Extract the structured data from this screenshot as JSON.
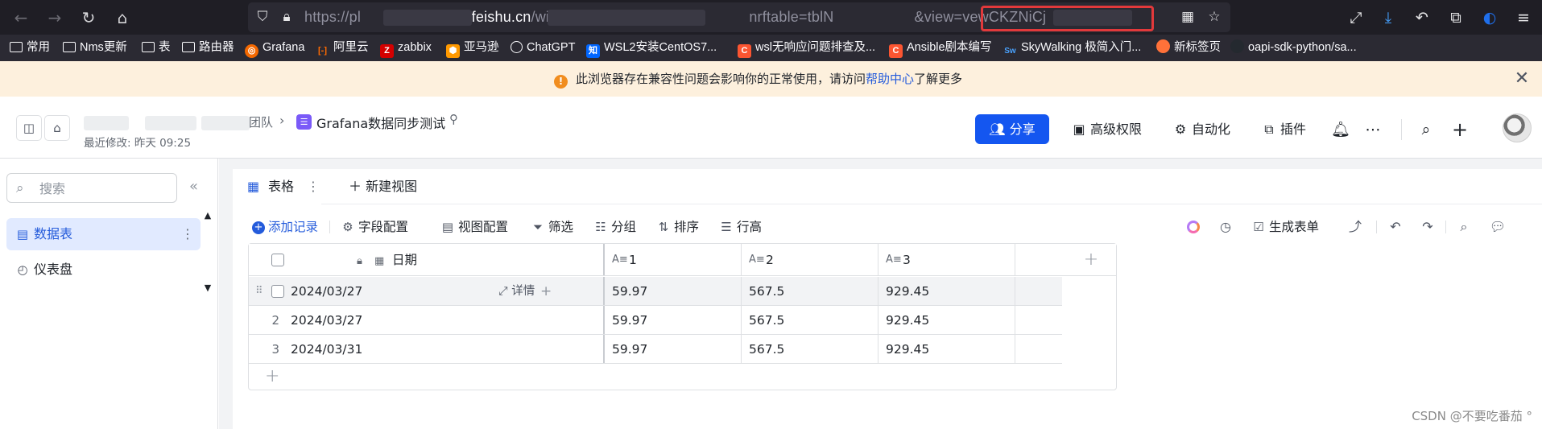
{
  "browser": {
    "url_prefix": "https://pl",
    "url_host": "e3.feishu.cn",
    "url_path": "/wiki/AJn",
    "url_mid": "nrf",
    "url_table": "table=tblN",
    "url_view": "&view=vewCKZNiCj"
  },
  "bookmarks": [
    {
      "label": "常用",
      "icon": "folder-icon"
    },
    {
      "label": "Nms更新",
      "icon": "folder-icon"
    },
    {
      "label": "表",
      "icon": "folder-icon"
    },
    {
      "label": "路由器",
      "icon": "folder-icon"
    },
    {
      "label": "Grafana",
      "icon": "grafana-icon"
    },
    {
      "label": "阿里云",
      "icon": "aliyun-icon"
    },
    {
      "label": "zabbix",
      "icon": "zabbix-icon"
    },
    {
      "label": "亚马逊",
      "icon": "amazon-icon"
    },
    {
      "label": "ChatGPT",
      "icon": "globe-icon"
    },
    {
      "label": "WSL2安装CentOS7...",
      "icon": "zhihu-icon"
    },
    {
      "label": "wsl无响应问题排查及...",
      "icon": "csdn-icon"
    },
    {
      "label": "Ansible剧本编写",
      "icon": "csdn-icon"
    },
    {
      "label": "SkyWalking 极简入门...",
      "icon": "skywalking-icon"
    },
    {
      "label": "新标签页",
      "icon": "firefox-icon"
    },
    {
      "label": "oapi-sdk-python/sa...",
      "icon": "github-icon"
    }
  ],
  "notice": {
    "text_before": "此浏览器存在兼容性问题会影响你的正常使用，请访问",
    "link": "帮助中心",
    "text_after": "了解更多"
  },
  "header": {
    "crumb_team": "团队",
    "doc_title": "Grafana数据同步测试",
    "last_modified": "最近修改: 昨天 09:25",
    "share_label": "分享",
    "permissions_label": "高级权限",
    "automation_label": "自动化",
    "plugins_label": "插件"
  },
  "sidebar": {
    "search_placeholder": "搜索",
    "items": [
      {
        "label": "数据表",
        "icon": "table-icon",
        "active": true
      },
      {
        "label": "仪表盘",
        "icon": "dashboard-icon",
        "active": false
      }
    ]
  },
  "tabs": {
    "active_label": "表格",
    "new_view_label": "新建视图"
  },
  "toolbar": {
    "add_record": "添加记录",
    "field_config": "字段配置",
    "view_config": "视图配置",
    "filter": "筛选",
    "group": "分组",
    "sort": "排序",
    "row_height": "行高",
    "generate_form": "生成表单"
  },
  "table": {
    "columns": [
      "日期",
      "1",
      "2",
      "3"
    ],
    "detail_label": "详情",
    "rows": [
      {
        "num": "",
        "date": "2024/03/27",
        "c1": "59.97",
        "c2": "567.5",
        "c3": "929.45"
      },
      {
        "num": "2",
        "date": "2024/03/27",
        "c1": "59.97",
        "c2": "567.5",
        "c3": "929.45"
      },
      {
        "num": "3",
        "date": "2024/03/31",
        "c1": "59.97",
        "c2": "567.5",
        "c3": "929.45"
      }
    ]
  },
  "watermark": "CSDN @不要吃番茄 °"
}
